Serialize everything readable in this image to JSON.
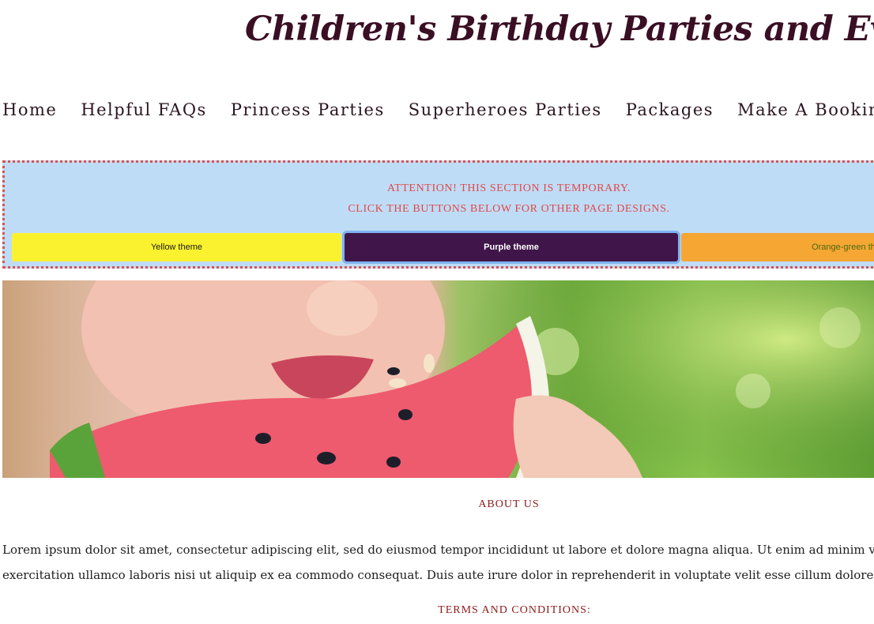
{
  "header": {
    "site_title": "Children's Birthday Parties and Events"
  },
  "nav": {
    "items": [
      "Home",
      "Helpful FAQs",
      "Princess Parties",
      "Superheroes Parties",
      "Packages",
      "Make A Booking / Con"
    ]
  },
  "notice": {
    "line1": "ATTENTION! THIS SECTION IS TEMPORARY.",
    "line2": "CLICK THE BUTTONS BELOW FOR OTHER PAGE DESIGNS.",
    "border_color": "#d9534f",
    "background": "#bfdcf6"
  },
  "theme_buttons": [
    {
      "label": "Yellow theme",
      "color": "#fbf22f"
    },
    {
      "label": "Purple theme",
      "color": "#40164a",
      "active": true
    },
    {
      "label": "Orange-green the",
      "color": "#f5a633"
    }
  ],
  "hero": {
    "image": "child-eating-watermelon"
  },
  "about": {
    "title": "ABOUT US",
    "line1": "Lorem ipsum dolor sit amet, consectetur adipiscing elit, sed do eiusmod tempor incididunt ut labore et dolore magna aliqua. Ut enim ad minim venia",
    "line2": "exercitation ullamco laboris nisi ut aliquip ex ea commodo consequat. Duis aute irure dolor in reprehenderit in voluptate velit esse cillum dolore eu f"
  },
  "terms": {
    "title": "TERMS AND CONDITIONS:"
  },
  "colors": {
    "title": "#3a0f24",
    "accent_red": "#8e1b1b"
  }
}
